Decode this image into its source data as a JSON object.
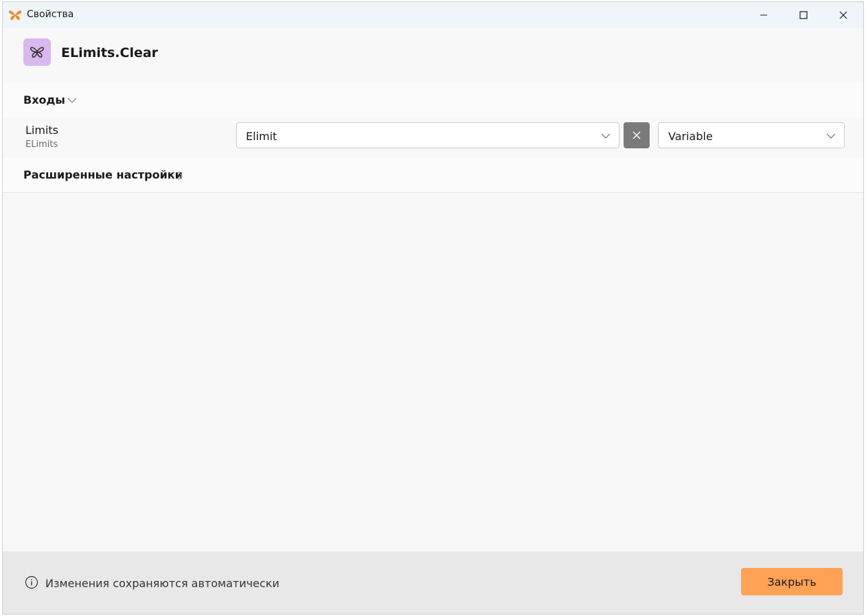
{
  "window": {
    "title": "Свойства"
  },
  "header": {
    "name": "ELimits.Clear"
  },
  "sections": {
    "inputs_label": "Входы",
    "advanced_label": "Расширенные настройки"
  },
  "parameter": {
    "name": "Limits",
    "type": "ELimits",
    "value": "Elimit",
    "kind": "Variable"
  },
  "footer": {
    "message": "Изменения сохраняются автоматически",
    "close_label": "Закрыть"
  },
  "colors": {
    "accent": "#ffa256",
    "badge": "#d9b8f0",
    "clear_button": "#7a7a7a"
  }
}
